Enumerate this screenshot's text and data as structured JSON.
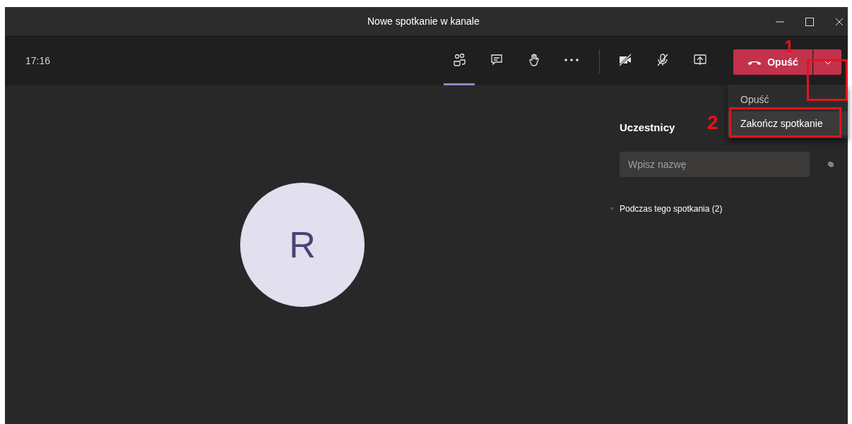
{
  "window": {
    "title": "Nowe spotkanie w kanale"
  },
  "toolbar": {
    "time": "17:16",
    "buttons": [
      {
        "kind": "people",
        "selected": true
      },
      {
        "kind": "chat",
        "selected": false
      },
      {
        "kind": "hand",
        "selected": false
      },
      {
        "kind": "more",
        "selected": false
      },
      {
        "kind": "camera",
        "selected": false
      },
      {
        "kind": "mic",
        "selected": false
      },
      {
        "kind": "share",
        "selected": false
      }
    ],
    "leave_button": {
      "label": "Opuść"
    }
  },
  "leave_menu": {
    "items": [
      {
        "label": "Opuść",
        "selected": false
      },
      {
        "label": "Zakończ spotkanie",
        "selected": true
      }
    ]
  },
  "annotations": [
    {
      "label": "1"
    },
    {
      "label": "2"
    }
  ],
  "participants": {
    "title": "Uczestnicy",
    "search": {
      "placeholder": "Wpisz nazwę"
    },
    "section": {
      "label": "Podczas tego spotkania (2)"
    }
  },
  "avatar": {
    "initial": "R"
  }
}
